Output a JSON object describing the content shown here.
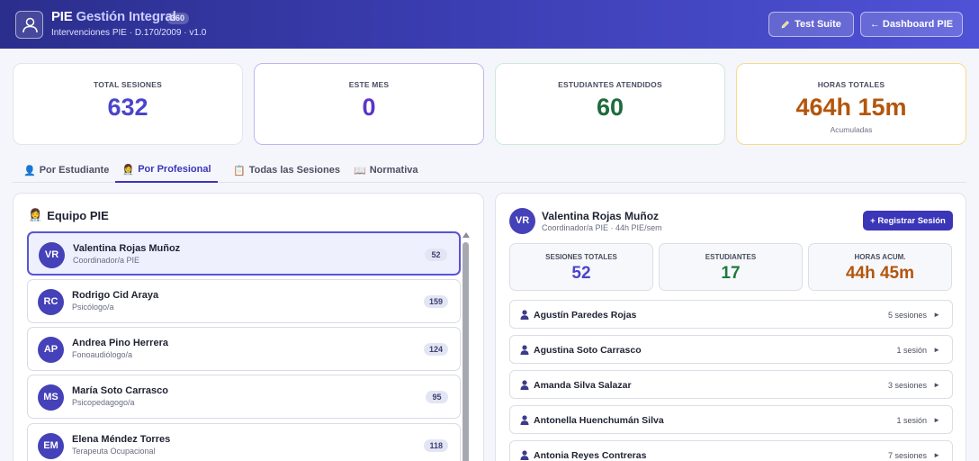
{
  "header": {
    "title_pie": "PIE",
    "title_rest": "Gestión Integral",
    "badge": "360",
    "subtitle": "Intervenciones PIE · D.170/2009 · v1.0",
    "test_suite_label": "Test Suite",
    "dashboard_label": "← Dashboard PIE",
    "logo_icon": "user-icon"
  },
  "stats": [
    {
      "label": "TOTAL SESIONES",
      "value": "632",
      "sub": ""
    },
    {
      "label": "ESTE MES",
      "value": "0",
      "sub": ""
    },
    {
      "label": "ESTUDIANTES ATENDIDOS",
      "value": "60",
      "sub": ""
    },
    {
      "label": "HORAS TOTALES",
      "value": "464h 15m",
      "sub": "Acumuladas"
    }
  ],
  "tabs": [
    {
      "icon": "👤",
      "label": "Por Estudiante"
    },
    {
      "icon": "👩‍⚕️",
      "label": "Por Profesional"
    },
    {
      "icon": "📋",
      "label": "Todas las Sesiones"
    },
    {
      "icon": "📖",
      "label": "Normativa"
    }
  ],
  "team": {
    "icon": "👩‍⚕️",
    "title": "Equipo PIE",
    "members": [
      {
        "initials": "VR",
        "name": "Valentina Rojas Muñoz",
        "role": "Coordinador/a PIE",
        "count": "52"
      },
      {
        "initials": "RC",
        "name": "Rodrigo Cid Araya",
        "role": "Psicólogo/a",
        "count": "159"
      },
      {
        "initials": "AP",
        "name": "Andrea Pino Herrera",
        "role": "Fonoaudiólogo/a",
        "count": "124"
      },
      {
        "initials": "MS",
        "name": "María Soto Carrasco",
        "role": "Psicopedagogo/a",
        "count": "95"
      },
      {
        "initials": "EM",
        "name": "Elena Méndez Torres",
        "role": "Terapeuta Ocupacional",
        "count": "118"
      }
    ]
  },
  "detail": {
    "initials": "VR",
    "name": "Valentina Rojas Muñoz",
    "role": "Coordinador/a PIE · 44h PIE/sem",
    "register_label": "+ Registrar Sesión",
    "stats": [
      {
        "label": "SESIONES TOTALES",
        "value": "52"
      },
      {
        "label": "ESTUDIANTES",
        "value": "17"
      },
      {
        "label": "HORAS ACUM.",
        "value": "44h 45m"
      }
    ],
    "students": [
      {
        "name": "Agustín Paredes Rojas",
        "sessions": "5 sesiones"
      },
      {
        "name": "Agustina Soto Carrasco",
        "sessions": "1 sesión"
      },
      {
        "name": "Amanda Silva Salazar",
        "sessions": "3 sesiones"
      },
      {
        "name": "Antonella Huenchumán Silva",
        "sessions": "1 sesión"
      },
      {
        "name": "Antonia Reyes Contreras",
        "sessions": "7 sesiones"
      }
    ]
  },
  "colors": {
    "accent": "#3b36b8",
    "header_start": "#2b2e8c",
    "header_end": "#4f52d6"
  }
}
